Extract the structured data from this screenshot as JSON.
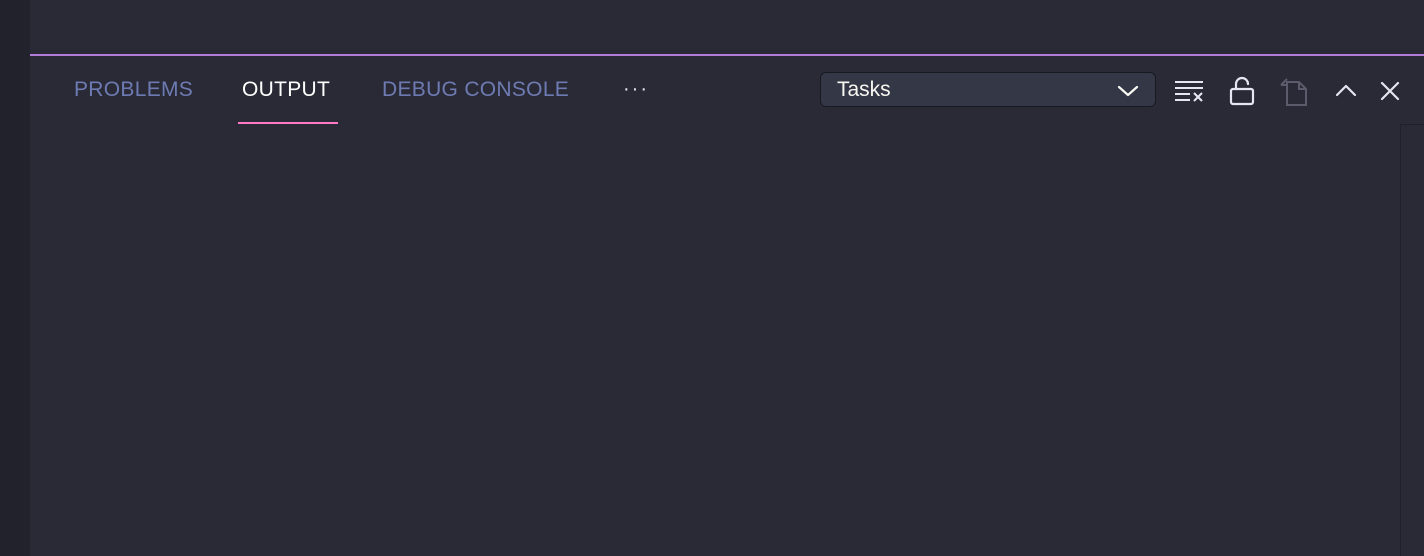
{
  "panel": {
    "tabs": [
      {
        "label": "PROBLEMS",
        "active": false
      },
      {
        "label": "OUTPUT",
        "active": true
      },
      {
        "label": "DEBUG CONSOLE",
        "active": false
      }
    ],
    "more_label": "···",
    "output_channel": {
      "selected": "Tasks"
    },
    "actions": [
      {
        "name": "clear-output",
        "icon": "clear-all-icon",
        "enabled": true
      },
      {
        "name": "toggle-lock",
        "icon": "unlock-icon",
        "enabled": true
      },
      {
        "name": "open-log-file",
        "icon": "go-to-file-icon",
        "enabled": false
      },
      {
        "name": "maximize-panel",
        "icon": "chevron-up-icon",
        "enabled": true
      },
      {
        "name": "close-panel",
        "icon": "close-icon",
        "enabled": true
      }
    ]
  },
  "colors": {
    "background": "#292a36",
    "accent_border": "#b07cd8",
    "active_tab_underline": "#ff79c6",
    "inactive_tab_text": "#6e7bb3",
    "active_tab_text": "#ffffff"
  }
}
